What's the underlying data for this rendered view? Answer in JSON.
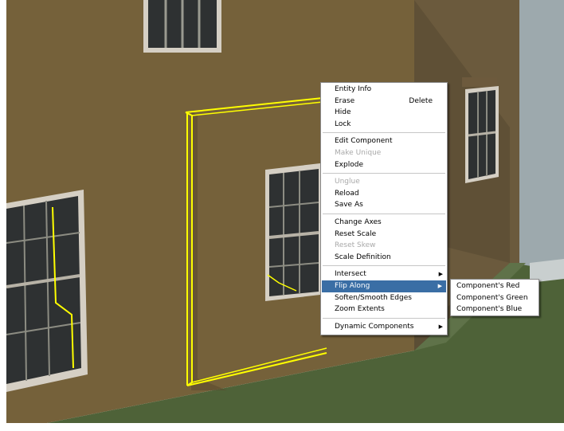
{
  "context_menu": {
    "groups": [
      [
        {
          "label": "Entity Info",
          "enabled": true
        },
        {
          "label": "Erase",
          "shortcut": "Delete",
          "enabled": true
        },
        {
          "label": "Hide",
          "enabled": true
        },
        {
          "label": "Lock",
          "enabled": true
        }
      ],
      [
        {
          "label": "Edit Component",
          "enabled": true
        },
        {
          "label": "Make Unique",
          "enabled": false
        },
        {
          "label": "Explode",
          "enabled": true
        }
      ],
      [
        {
          "label": "Unglue",
          "enabled": false
        },
        {
          "label": "Reload",
          "enabled": true
        },
        {
          "label": "Save As",
          "enabled": true
        }
      ],
      [
        {
          "label": "Change Axes",
          "enabled": true
        },
        {
          "label": "Reset Scale",
          "enabled": true
        },
        {
          "label": "Reset Skew",
          "enabled": false
        },
        {
          "label": "Scale Definition",
          "enabled": true
        }
      ],
      [
        {
          "label": "Intersect",
          "enabled": true,
          "submenu": true
        },
        {
          "label": "Flip Along",
          "enabled": true,
          "submenu": true,
          "highlighted": true
        },
        {
          "label": "Soften/Smooth Edges",
          "enabled": true
        },
        {
          "label": "Zoom Extents",
          "enabled": true
        }
      ],
      [
        {
          "label": "Dynamic Components",
          "enabled": true,
          "submenu": true
        }
      ]
    ]
  },
  "submenu": {
    "items": [
      {
        "label": "Component's Red"
      },
      {
        "label": "Component's Green"
      },
      {
        "label": "Component's Blue"
      }
    ]
  },
  "colors": {
    "wall": "#73603a",
    "ground": "#4f6138",
    "sky": "#ffffff",
    "selection": "#ffff00",
    "menu_highlight": "#3a6ea5"
  },
  "icons": {
    "submenu_indicator": "triangle-right"
  }
}
